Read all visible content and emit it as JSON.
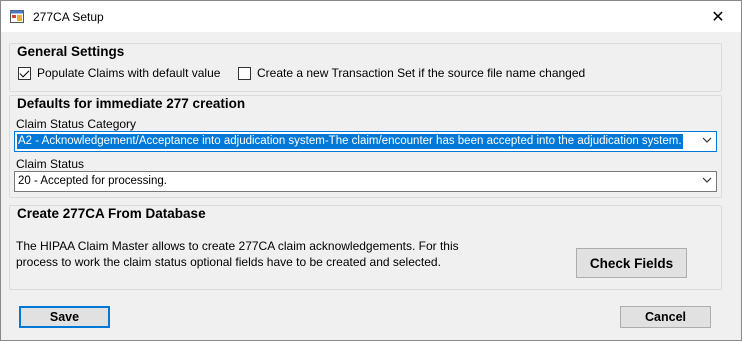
{
  "window": {
    "title": "277CA Setup",
    "icon": "app-window-icon",
    "close_glyph": "✕"
  },
  "general_settings": {
    "title": "General Settings",
    "populate_claims": {
      "label": "Populate Claims with default value",
      "checked": true
    },
    "new_transaction_set": {
      "label": "Create a new Transaction Set if the source file name changed",
      "checked": false
    }
  },
  "defaults": {
    "title": "Defaults for immediate 277 creation",
    "claim_status_category": {
      "label": "Claim Status Category",
      "value": "A2 - Acknowledgement/Acceptance into adjudication system-The claim/encounter has been accepted into the adjudication system."
    },
    "claim_status": {
      "label": "Claim Status",
      "value": "20 - Accepted for processing."
    }
  },
  "database": {
    "title": "Create 277CA From Database",
    "description": "The HIPAA Claim Master allows to create 277CA claim acknowledgements. For this process to work the claim status optional fields have to be created and selected.",
    "check_fields_label": "Check Fields"
  },
  "footer": {
    "save_label": "Save",
    "cancel_label": "Cancel"
  },
  "colors": {
    "accent": "#0078d7",
    "dialog_bg": "#f0f0f0"
  }
}
